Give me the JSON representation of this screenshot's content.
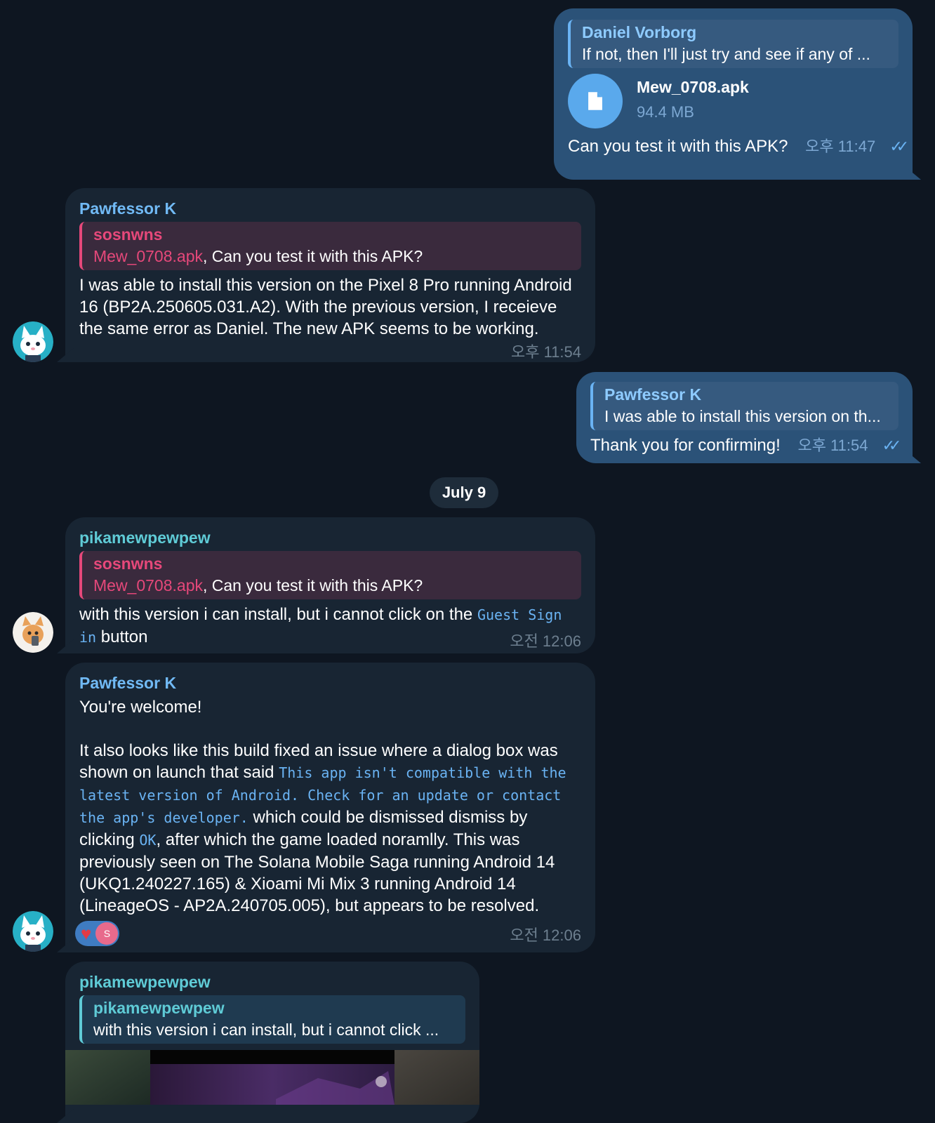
{
  "messages": [
    {
      "reply_name": "Daniel Vorborg",
      "reply_text": "If not, then I'll just try and see if any of ...",
      "file_name": "Mew_0708.apk",
      "file_size": "94.4 MB",
      "text": "Can you test it with this APK?",
      "time": "오후 11:47"
    },
    {
      "sender": "Pawfessor K",
      "reply_name": "sosnwns",
      "reply_link": "Mew_0708.apk",
      "reply_text": ", Can you test it with this APK?",
      "text": "I was able to install this version on the Pixel 8 Pro running Android 16 (BP2A.250605.031.A2). With the previous version, I receieve the same error as Daniel. The new APK seems to be working.",
      "time": "오후 11:54"
    },
    {
      "reply_name": "Pawfessor K",
      "reply_text": "I was able to install this version on th...",
      "text": "Thank you for confirming!",
      "time": "오후 11:54"
    },
    {
      "sender": "pikamewpewpew",
      "reply_name": "sosnwns",
      "reply_link": "Mew_0708.apk",
      "reply_text": ", Can you test it with this APK?",
      "text_before": "with this version i can install, but i cannot click on the ",
      "code": "Guest Sign in",
      "text_after": " button",
      "time": "오전 12:06"
    },
    {
      "sender": "Pawfessor K",
      "line1": "You're welcome!",
      "p2_before": "It also looks like this build fixed an issue where a dialog box was shown on launch that said ",
      "p2_code": "This app isn't compatible with the latest version of Android. Check for an update or contact the app's developer.",
      "p2_mid": " which could be dismissed dismiss by clicking ",
      "p2_code2": "OK",
      "p2_after": ", after which the game loaded noramlly. This was previously seen on The Solana Mobile Saga running Android 14 (UKQ1.240227.165) & Xioami Mi Mix 3 running Android 14 (LineageOS - AP2A.240705.005), but appears to be resolved.",
      "reaction_emoji": "heart",
      "reaction_avatar": "S",
      "time": "오전 12:06"
    },
    {
      "sender": "pikamewpewpew",
      "reply_name": "pikamewpewpew",
      "reply_text": "with this version i can install, but i cannot click ..."
    }
  ],
  "date_separator": "July 9",
  "colors": {
    "background": "#0e1621",
    "incoming_bubble": "#182533",
    "outgoing_bubble": "#2b5278",
    "accent": "#6ab3f3",
    "quote_pink": "#e6487a"
  }
}
